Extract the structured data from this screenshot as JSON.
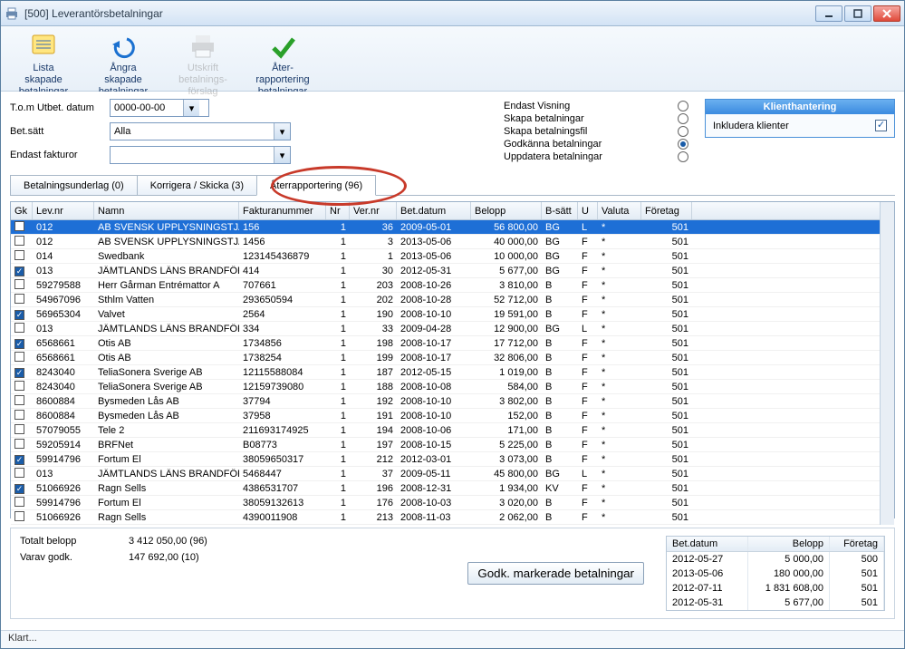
{
  "window": {
    "title": "[500] Leverantörsbetalningar"
  },
  "toolbar": {
    "list": {
      "l1": "Lista",
      "l2": "skapade",
      "l3": "betalningar"
    },
    "undo": {
      "l1": "Ångra",
      "l2": "skapade",
      "l3": "betalningar"
    },
    "print": {
      "l1": "Utskrift",
      "l2": "betalnings-",
      "l3": "förslag"
    },
    "report": {
      "l1": "Åter-",
      "l2": "rapportering",
      "l3": "betalningar"
    }
  },
  "filters": {
    "date_label": "T.o.m Utbet. datum",
    "date_value": "0000-00-00",
    "paymethod_label": "Bet.sätt",
    "paymethod_value": "Alla",
    "invoices_label": "Endast fakturor",
    "invoices_value": ""
  },
  "modes": {
    "view": "Endast Visning",
    "create": "Skapa betalningar",
    "createfile": "Skapa betalningsfil",
    "approve": "Godkänna betalningar",
    "update": "Uppdatera betalningar",
    "selected": "approve"
  },
  "sidebox": {
    "title": "Klienthantering",
    "label": "Inkludera klienter",
    "checked": true
  },
  "tabs": {
    "t0": "Betalningsunderlag (0)",
    "t1": "Korrigera / Skicka (3)",
    "t2": "Återrapportering (96)"
  },
  "columns": {
    "gk": "Gk",
    "lev": "Lev.nr",
    "namn": "Namn",
    "fakt": "Fakturanummer",
    "nr": "Nr",
    "ver": "Ver.nr",
    "bet": "Bet.datum",
    "belopp": "Belopp",
    "bsatt": "B-sätt",
    "u": "U",
    "valuta": "Valuta",
    "foretag": "Företag"
  },
  "rows": [
    {
      "gk": false,
      "sel": true,
      "lev": "012",
      "namn": "AB SVENSK UPPLYSNINGSTJÄ",
      "fakt": "156",
      "nr": "1",
      "ver": "36",
      "bet": "2009-05-01",
      "belopp": "56 800,00",
      "bsatt": "BG",
      "u": "L",
      "val": "*",
      "for": "501"
    },
    {
      "gk": false,
      "lev": "012",
      "namn": "AB SVENSK UPPLYSNINGSTJÄ",
      "fakt": "1456",
      "nr": "1",
      "ver": "3",
      "bet": "2013-05-06",
      "belopp": "40 000,00",
      "bsatt": "BG",
      "u": "F",
      "val": "*",
      "for": "501"
    },
    {
      "gk": false,
      "lev": "014",
      "namn": "Swedbank",
      "fakt": "123145436879",
      "nr": "1",
      "ver": "1",
      "bet": "2013-05-06",
      "belopp": "10 000,00",
      "bsatt": "BG",
      "u": "F",
      "val": "*",
      "for": "501"
    },
    {
      "gk": true,
      "lev": "013",
      "namn": "JÄMTLANDS LÄNS BRANDFÖR",
      "fakt": "414",
      "nr": "1",
      "ver": "30",
      "bet": "2012-05-31",
      "belopp": "5 677,00",
      "bsatt": "BG",
      "u": "F",
      "val": "*",
      "for": "501"
    },
    {
      "gk": false,
      "lev": "59279588",
      "namn": "Herr Gårman Entrémattor A",
      "fakt": "707661",
      "nr": "1",
      "ver": "203",
      "bet": "2008-10-26",
      "belopp": "3 810,00",
      "bsatt": "B",
      "u": "F",
      "val": "*",
      "for": "501"
    },
    {
      "gk": false,
      "lev": "54967096",
      "namn": "Sthlm Vatten",
      "fakt": "293650594",
      "nr": "1",
      "ver": "202",
      "bet": "2008-10-28",
      "belopp": "52 712,00",
      "bsatt": "B",
      "u": "F",
      "val": "*",
      "for": "501"
    },
    {
      "gk": true,
      "lev": "56965304",
      "namn": "Valvet",
      "fakt": "2564",
      "nr": "1",
      "ver": "190",
      "bet": "2008-10-10",
      "belopp": "19 591,00",
      "bsatt": "B",
      "u": "F",
      "val": "*",
      "for": "501"
    },
    {
      "gk": false,
      "lev": "013",
      "namn": "JÄMTLANDS LÄNS BRANDFÖR",
      "fakt": "334",
      "nr": "1",
      "ver": "33",
      "bet": "2009-04-28",
      "belopp": "12 900,00",
      "bsatt": "BG",
      "u": "L",
      "val": "*",
      "for": "501"
    },
    {
      "gk": true,
      "lev": "6568661",
      "namn": "Otis AB",
      "fakt": "1734856",
      "nr": "1",
      "ver": "198",
      "bet": "2008-10-17",
      "belopp": "17 712,00",
      "bsatt": "B",
      "u": "F",
      "val": "*",
      "for": "501"
    },
    {
      "gk": false,
      "lev": "6568661",
      "namn": "Otis AB",
      "fakt": "1738254",
      "nr": "1",
      "ver": "199",
      "bet": "2008-10-17",
      "belopp": "32 806,00",
      "bsatt": "B",
      "u": "F",
      "val": "*",
      "for": "501"
    },
    {
      "gk": true,
      "lev": "8243040",
      "namn": "TeliaSonera Sverige AB",
      "fakt": "12115588084",
      "nr": "1",
      "ver": "187",
      "bet": "2012-05-15",
      "belopp": "1 019,00",
      "bsatt": "B",
      "u": "F",
      "val": "*",
      "for": "501"
    },
    {
      "gk": false,
      "lev": "8243040",
      "namn": "TeliaSonera Sverige AB",
      "fakt": "12159739080",
      "nr": "1",
      "ver": "188",
      "bet": "2008-10-08",
      "belopp": "584,00",
      "bsatt": "B",
      "u": "F",
      "val": "*",
      "for": "501"
    },
    {
      "gk": false,
      "lev": "8600884",
      "namn": "Bysmeden Lås AB",
      "fakt": "37794",
      "nr": "1",
      "ver": "192",
      "bet": "2008-10-10",
      "belopp": "3 802,00",
      "bsatt": "B",
      "u": "F",
      "val": "*",
      "for": "501"
    },
    {
      "gk": false,
      "lev": "8600884",
      "namn": "Bysmeden Lås AB",
      "fakt": "37958",
      "nr": "1",
      "ver": "191",
      "bet": "2008-10-10",
      "belopp": "152,00",
      "bsatt": "B",
      "u": "F",
      "val": "*",
      "for": "501"
    },
    {
      "gk": false,
      "lev": "57079055",
      "namn": "Tele 2",
      "fakt": "211693174925",
      "nr": "1",
      "ver": "194",
      "bet": "2008-10-06",
      "belopp": "171,00",
      "bsatt": "B",
      "u": "F",
      "val": "*",
      "for": "501"
    },
    {
      "gk": false,
      "lev": "59205914",
      "namn": "BRFNet",
      "fakt": "B08773",
      "nr": "1",
      "ver": "197",
      "bet": "2008-10-15",
      "belopp": "5 225,00",
      "bsatt": "B",
      "u": "F",
      "val": "*",
      "for": "501"
    },
    {
      "gk": true,
      "lev": "59914796",
      "namn": "Fortum El",
      "fakt": "38059650317",
      "nr": "1",
      "ver": "212",
      "bet": "2012-03-01",
      "belopp": "3 073,00",
      "bsatt": "B",
      "u": "F",
      "val": "*",
      "for": "501"
    },
    {
      "gk": false,
      "lev": "013",
      "namn": "JÄMTLANDS LÄNS BRANDFÖR",
      "fakt": "5468447",
      "nr": "1",
      "ver": "37",
      "bet": "2009-05-11",
      "belopp": "45 800,00",
      "bsatt": "BG",
      "u": "L",
      "val": "*",
      "for": "501"
    },
    {
      "gk": true,
      "lev": "51066926",
      "namn": "Ragn Sells",
      "fakt": "4386531707",
      "nr": "1",
      "ver": "196",
      "bet": "2008-12-31",
      "belopp": "1 934,00",
      "bsatt": "KV",
      "u": "F",
      "val": "*",
      "for": "501"
    },
    {
      "gk": false,
      "lev": "59914796",
      "namn": "Fortum El",
      "fakt": "38059132613",
      "nr": "1",
      "ver": "176",
      "bet": "2008-10-03",
      "belopp": "3 020,00",
      "bsatt": "B",
      "u": "F",
      "val": "*",
      "for": "501"
    },
    {
      "gk": false,
      "lev": "51066926",
      "namn": "Ragn Sells",
      "fakt": "4390011908",
      "nr": "1",
      "ver": "213",
      "bet": "2008-11-03",
      "belopp": "2 062,00",
      "bsatt": "B",
      "u": "F",
      "val": "*",
      "for": "501"
    }
  ],
  "summary": {
    "total_label": "Totalt belopp",
    "total_value": "3 412 050,00  (96)",
    "approved_label": "Varav godk.",
    "approved_value": "147 692,00  (10)",
    "approve_btn": "Godk. markerade betalningar"
  },
  "sum_table": {
    "h_bet": "Bet.datum",
    "h_belopp": "Belopp",
    "h_for": "Företag",
    "rows": [
      {
        "d": "2012-05-27",
        "b": "5 000,00",
        "f": "500"
      },
      {
        "d": "2013-05-06",
        "b": "180 000,00",
        "f": "501"
      },
      {
        "d": "2012-07-11",
        "b": "1 831 608,00",
        "f": "501"
      },
      {
        "d": "2012-05-31",
        "b": "5 677,00",
        "f": "501"
      }
    ]
  },
  "status": "Klart..."
}
